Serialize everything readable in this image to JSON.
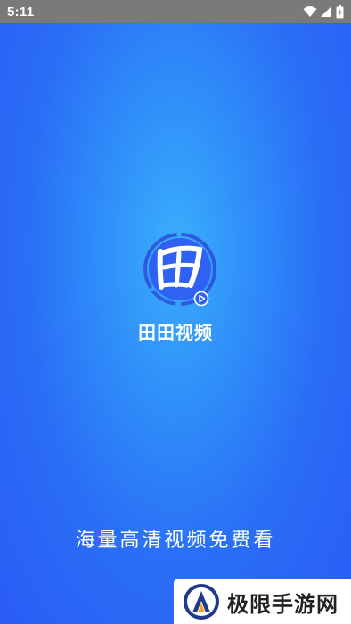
{
  "status_bar": {
    "time": "5:11",
    "icons": [
      "wifi-icon",
      "signal-icon",
      "battery-icon"
    ]
  },
  "splash": {
    "logo_icon": "tian-logo-icon",
    "play_icon": "play-icon",
    "app_name": "田田视频",
    "slogan": "海量高清视频免费看"
  },
  "watermark": {
    "logo_icon": "site-logo-icon",
    "text": "极限手游网"
  },
  "colors": {
    "background_center": "#3aaefc",
    "background_edge": "#2a5cf5",
    "status_bar": "#7a7a7a",
    "logo_circle": "#2f62f2",
    "text": "#ffffff"
  }
}
